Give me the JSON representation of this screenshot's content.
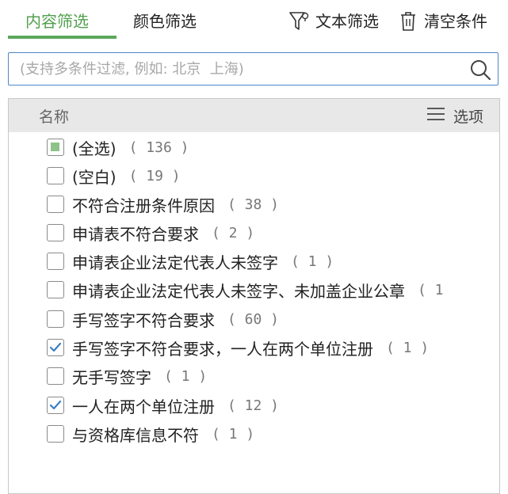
{
  "tabs": [
    {
      "label": "内容筛选",
      "active": true
    },
    {
      "label": "颜色筛选",
      "active": false
    }
  ],
  "toolbar": {
    "text_filter_label": "文本筛选",
    "clear_label": "清空条件"
  },
  "search": {
    "placeholder": "(支持多条件过滤, 例如: 北京  上海)"
  },
  "list": {
    "header_name": "名称",
    "header_options": "选项",
    "items": [
      {
        "label": "(全选)",
        "count": "( 136 )",
        "state": "partial"
      },
      {
        "label": "(空白)",
        "count": "( 19 )",
        "state": "unchecked"
      },
      {
        "label": "不符合注册条件原因",
        "count": "( 38 )",
        "state": "unchecked"
      },
      {
        "label": "申请表不符合要求",
        "count": "( 2 )",
        "state": "unchecked"
      },
      {
        "label": "申请表企业法定代表人未签字",
        "count": "( 1 )",
        "state": "unchecked"
      },
      {
        "label": "申请表企业法定代表人未签字、未加盖企业公章",
        "count": "( 1",
        "state": "unchecked"
      },
      {
        "label": "手写签字不符合要求",
        "count": "( 60 )",
        "state": "unchecked"
      },
      {
        "label": "手写签字不符合要求，一人在两个单位注册",
        "count": "( 1 )",
        "state": "checked"
      },
      {
        "label": "无手写签字",
        "count": "( 1 )",
        "state": "unchecked"
      },
      {
        "label": "一人在两个单位注册",
        "count": "( 12 )",
        "state": "checked"
      },
      {
        "label": "与资格库信息不符",
        "count": "( 1 )",
        "state": "unchecked"
      }
    ]
  },
  "colors": {
    "accent_green": "#5aa85a",
    "search_border": "#4f86c6",
    "check_blue": "#3b7fc4"
  },
  "icons": [
    "filter-icon",
    "trash-icon",
    "search-icon",
    "menu-icon",
    "checkmark-icon"
  ]
}
